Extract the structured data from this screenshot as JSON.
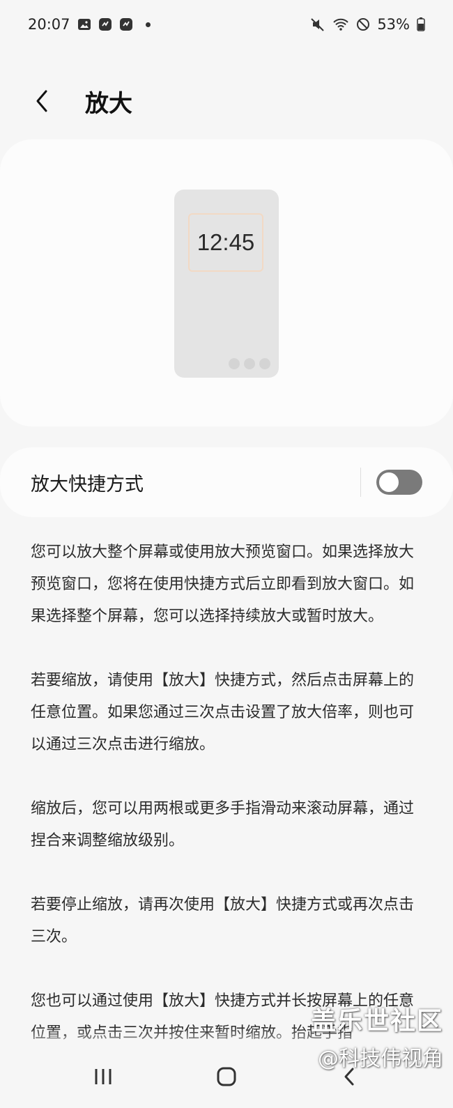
{
  "status_bar": {
    "time": "20:07",
    "battery": "53%",
    "left_icons": [
      "gallery-icon",
      "app-icon",
      "app-icon"
    ],
    "right_icons": [
      "mute-icon",
      "wifi-icon",
      "dnd-icon",
      "battery-icon"
    ]
  },
  "header": {
    "title": "放大"
  },
  "preview": {
    "clock": "12:45"
  },
  "shortcut": {
    "label": "放大快捷方式",
    "enabled": false
  },
  "description": {
    "paragraphs": [
      "您可以放大整个屏幕或使用放大预览窗口。如果选择放大预览窗口，您将在使用快捷方式后立即看到放大窗口。如果选择整个屏幕，您可以选择持续放大或暂时放大。",
      "若要缩放，请使用【放大】快捷方式，然后点击屏幕上的任意位置。如果您通过三次点击设置了放大倍率，则也可以通过三次点击进行缩放。",
      "缩放后，您可以用两根或更多手指滑动来滚动屏幕，通过捏合来调整缩放级别。",
      "若要停止缩放，请再次使用【放大】快捷方式或再次点击三次。",
      "您也可以通过使用【放大】快捷方式并长按屏幕上的任意位置，或点击三次并按住来暂时缩放。抬起手指"
    ]
  },
  "watermark": {
    "line1": "盖乐世社区",
    "line2": "@科技伟视角"
  },
  "nav": {
    "icons": [
      "recents-icon",
      "home-icon",
      "back-icon"
    ]
  }
}
